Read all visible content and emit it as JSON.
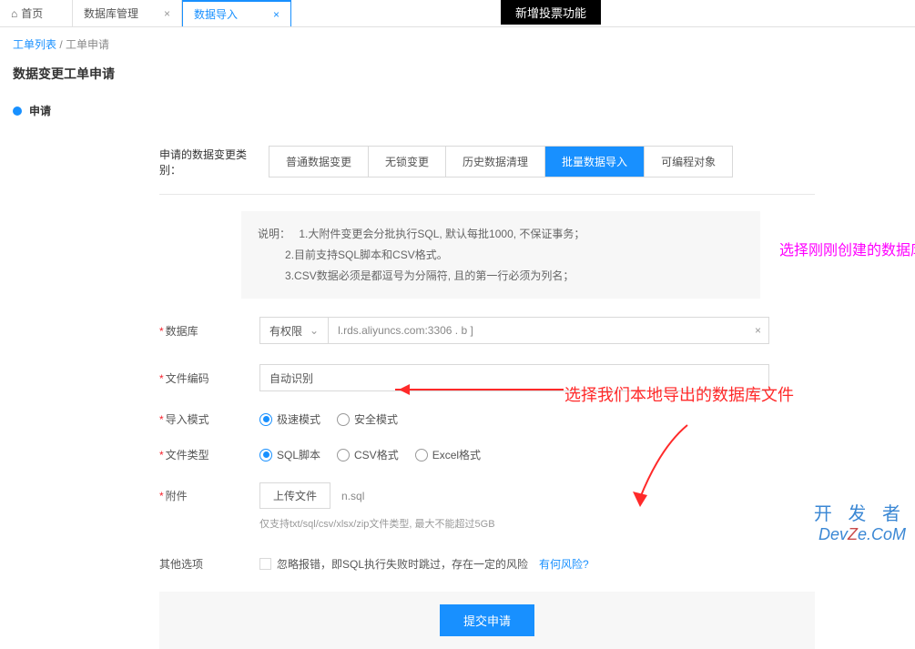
{
  "top_banner": "新增投票功能",
  "tabs": {
    "home": "首页",
    "db_mgmt": "数据库管理",
    "data_import": "数据导入"
  },
  "breadcrumb": {
    "l1": "工单列表",
    "sep": "/",
    "l2": "工单申请"
  },
  "page_title": "数据变更工单申请",
  "step": "申请",
  "category": {
    "label": "申请的数据变更类别：",
    "opts": [
      "普通数据变更",
      "无锁变更",
      "历史数据清理",
      "批量数据导入",
      "可编程对象"
    ]
  },
  "info": {
    "label": "说明：",
    "lines": [
      "1.大附件变更会分批执行SQL, 默认每批1000, 不保证事务；",
      "2.目前支持SQL脚本和CSV格式。",
      "3.CSV数据必须是都逗号为分隔符, 且的第一行必须为列名；"
    ]
  },
  "fields": {
    "database": {
      "label": "数据库",
      "perm": "有权限",
      "value": "l.rds.aliyuncs.com:3306 .                            b ]"
    },
    "encoding": {
      "label": "文件编码",
      "value": "自动识别"
    },
    "import_mode": {
      "label": "导入模式",
      "opts": [
        "极速模式",
        "安全模式"
      ]
    },
    "file_type": {
      "label": "文件类型",
      "opts": [
        "SQL脚本",
        "CSV格式",
        "Excel格式"
      ]
    },
    "attachment": {
      "label": "附件",
      "btn": "上传文件",
      "file": "n.sql",
      "hint": "仅支持txt/sql/csv/xlsx/zip文件类型, 最大不能超过5GB"
    },
    "other": {
      "label": "其他选项",
      "checkbox": "忽略报错，即SQL执行失败时跳过，存在一定的风险",
      "risk": "有何风险?"
    }
  },
  "submit": "提交申请",
  "annotations": {
    "a1": "选择刚刚创建的数据库",
    "a2": "选择我们本地导出的数据库文件"
  },
  "watermark": {
    "line1": "开 发 者",
    "line2a": "Dev",
    "line2b": "Z",
    "line2c": "e.CoM"
  }
}
